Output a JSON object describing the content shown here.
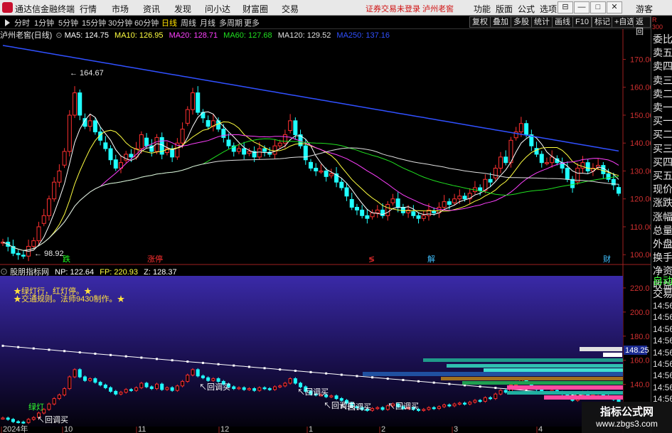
{
  "app": {
    "title": "通达信金融终端"
  },
  "menu": [
    "行情",
    "市场",
    "资讯",
    "发现",
    "问小达",
    "财富圈",
    "交易"
  ],
  "login_status": "证券交易未登录  泸州老窖",
  "tools": [
    "功能",
    "版面",
    "公式",
    "选项"
  ],
  "guest": "游客",
  "periods": [
    "分时",
    "1分钟",
    "5分钟",
    "15分钟",
    "30分钟",
    "60分钟",
    "日线",
    "周线",
    "月线",
    "多周期",
    "更多"
  ],
  "active_period": "日线",
  "right_buttons": [
    "复权",
    "叠加",
    "多股",
    "统计",
    "画线",
    "F10",
    "标记",
    "+自选",
    "返回"
  ],
  "main_chart": {
    "name": "泸州老窖(日线)",
    "ma": [
      {
        "label": "MA5: 124.75",
        "color": "#ffffff"
      },
      {
        "label": "MA10: 126.95",
        "color": "#ffff40"
      },
      {
        "label": "MA20: 128.71",
        "color": "#ff40ff"
      },
      {
        "label": "MA60: 127.68",
        "color": "#20e020"
      },
      {
        "label": "MA120: 129.52",
        "color": "#e0e0e0"
      },
      {
        "label": "MA250: 137.16",
        "color": "#3050ff"
      }
    ],
    "y_ticks": [
      "170.00",
      "160.00",
      "150.00",
      "140.00",
      "130.00",
      "120.00",
      "110.00",
      "100.00"
    ],
    "high_label": "164.67",
    "low_label": "98.92",
    "markers": [
      {
        "text": "跌",
        "color": "#20ff20"
      },
      {
        "text": "涨停",
        "color": "#ff3030"
      },
      {
        "text": "≶",
        "color": "#ff3030"
      },
      {
        "text": "解",
        "color": "#40c0ff"
      },
      {
        "text": "财",
        "color": "#40c0ff"
      }
    ]
  },
  "indicator": {
    "name": "股朋指标网",
    "values": [
      {
        "label": "NP: 122.64",
        "color": "#ffffff"
      },
      {
        "label": "FP: 220.93",
        "color": "#ffff40"
      },
      {
        "label": "Z: 128.37",
        "color": "#ffffff"
      }
    ],
    "notes": [
      "★绿灯行，红灯停。★",
      "★交通规则。法师9430制作。★"
    ],
    "y_ticks": [
      "220.0",
      "200.0",
      "180.0",
      "160.0",
      "140.0",
      "120.0"
    ],
    "current_value": "148.25",
    "signals": [
      "回调买",
      "回调买",
      "回调买",
      "回调买",
      "回调买",
      "回调买"
    ],
    "green_light": "绿灯",
    "x_labels": [
      "2024年",
      "10",
      "11",
      "12",
      "1",
      "2",
      "3",
      "4"
    ]
  },
  "side_panel": {
    "items": [
      "委比",
      "卖五",
      "卖四",
      "卖三",
      "卖二",
      "卖一",
      "买一",
      "买二",
      "买三",
      "买四",
      "买五",
      "现价",
      "涨跌",
      "涨幅",
      "总量",
      "外盘",
      "换手",
      "净资",
      "收益"
    ],
    "auto": "自动",
    "trade": "交易",
    "times": [
      "14:56",
      "14:56",
      "14:56",
      "14:56",
      "14:56",
      "14:56",
      "14:56",
      "14:56",
      "14:56"
    ],
    "rmark": "R\n300"
  },
  "watermark": {
    "line1": "指标公式网",
    "line2": "www.zbgs3.com"
  },
  "chart_data": [
    {
      "type": "candlestick",
      "title": "泸州老窖(日线)",
      "ylim": [
        97,
        177
      ],
      "high": 164.67,
      "low": 98.92,
      "close": [
        104.5,
        103,
        100.5,
        100,
        99.5,
        103,
        105,
        110,
        114,
        120,
        126,
        130,
        137,
        150,
        158,
        150,
        146,
        148,
        144,
        141,
        138,
        134,
        131,
        133,
        136,
        135,
        138,
        143,
        139,
        137,
        142,
        136,
        138,
        135,
        140,
        145,
        152,
        158,
        151,
        149,
        146,
        148,
        145,
        142,
        139,
        137,
        138,
        136,
        137,
        135,
        138,
        137,
        136,
        139,
        140,
        143,
        148,
        143,
        139,
        134,
        131,
        130,
        130,
        128,
        129,
        126,
        124,
        121,
        117,
        116,
        114,
        113,
        115,
        116,
        114,
        118,
        120,
        117,
        115,
        116,
        114,
        113,
        114,
        116,
        115,
        117,
        119,
        118,
        120,
        121,
        120,
        122,
        124,
        123,
        127,
        126,
        131,
        135,
        133,
        141,
        144,
        147,
        143,
        139,
        136,
        133,
        133,
        135,
        133,
        131,
        127,
        124,
        131,
        133,
        130,
        131,
        132,
        129,
        127,
        125,
        122
      ],
      "ma": {
        "MA5": 124.75,
        "MA10": 126.95,
        "MA20": 128.71,
        "MA60": 127.68,
        "MA120": 129.52,
        "MA250": 137.16
      }
    },
    {
      "type": "line",
      "title": "股朋指标网",
      "ylim": [
        105,
        230
      ],
      "series": [
        {
          "name": "NP",
          "last": 122.64
        },
        {
          "name": "FP",
          "last": 220.93
        },
        {
          "name": "Z",
          "last": 128.37
        }
      ]
    }
  ],
  "colors": {
    "up": "#ff3030",
    "down": "#20ffff",
    "ma250": "#3050ff",
    "ma20": "#ff40ff",
    "ma60": "#20e020",
    "ma10": "#ffff40",
    "ma5": "#ffffff",
    "ma120": "#e0e0e0"
  }
}
